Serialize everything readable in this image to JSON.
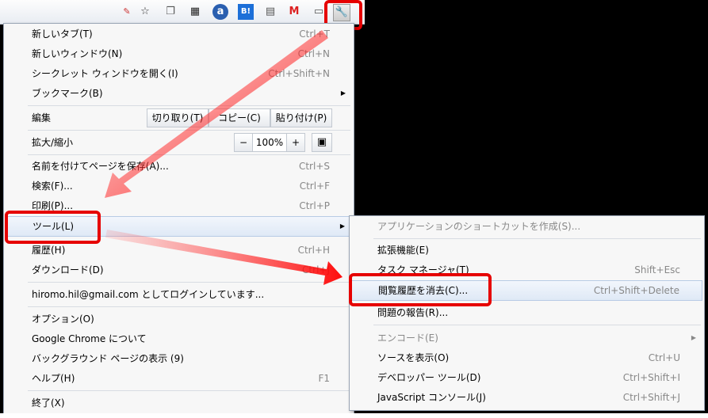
{
  "toolbar": {
    "icons": [
      "star-icon",
      "window-icon",
      "qr-icon",
      "a-icon",
      "hatena-bookmark-icon",
      "note-icon",
      "gmail-icon",
      "tab-icon",
      "wrench-icon"
    ],
    "b_label": "B!"
  },
  "main_menu": {
    "new_tab": {
      "label": "新しいタブ(T)",
      "shortcut": "Ctrl+T"
    },
    "new_window": {
      "label": "新しいウィンドウ(N)",
      "shortcut": "Ctrl+N"
    },
    "incognito": {
      "label": "シークレット ウィンドウを開く(I)",
      "shortcut": "Ctrl+Shift+N"
    },
    "bookmarks": {
      "label": "ブックマーク(B)"
    },
    "edit": {
      "label": "編集",
      "cut": "切り取り(T)",
      "copy": "コピー(C)",
      "paste": "貼り付け(P)"
    },
    "zoom": {
      "label": "拡大/縮小",
      "minus": "−",
      "value": "100%",
      "plus": "+"
    },
    "save_as": {
      "label": "名前を付けてページを保存(A)...",
      "shortcut": "Ctrl+S"
    },
    "find": {
      "label": "検索(F)...",
      "shortcut": "Ctrl+F"
    },
    "print": {
      "label": "印刷(P)...",
      "shortcut": "Ctrl+P"
    },
    "tools": {
      "label": "ツール(L)"
    },
    "history": {
      "label": "履歴(H)",
      "shortcut": "Ctrl+H"
    },
    "downloads": {
      "label": "ダウンロード(D)",
      "shortcut": "Ctrl+J"
    },
    "signed_in": {
      "label": "hiromo.hil@gmail.com としてログインしています..."
    },
    "options": {
      "label": "オプション(O)"
    },
    "about": {
      "label": "Google Chrome について"
    },
    "background": {
      "label": "バックグラウンド ページの表示 (9)"
    },
    "help": {
      "label": "ヘルプ(H)",
      "shortcut": "F1"
    },
    "exit": {
      "label": "終了(X)"
    }
  },
  "sub_menu": {
    "create_shortcut": {
      "label": "アプリケーションのショートカットを作成(S)..."
    },
    "extensions": {
      "label": "拡張機能(E)"
    },
    "task_manager": {
      "label": "タスク マネージャ(T)",
      "shortcut": "Shift+Esc"
    },
    "clear_data": {
      "label": "閲覧履歴を消去(C)...",
      "shortcut": "Ctrl+Shift+Delete"
    },
    "report_issue": {
      "label": "問題の報告(R)..."
    },
    "encoding": {
      "label": "エンコード(E)"
    },
    "view_source": {
      "label": "ソースを表示(O)",
      "shortcut": "Ctrl+U"
    },
    "dev_tools": {
      "label": "デベロッパー ツール(D)",
      "shortcut": "Ctrl+Shift+I"
    },
    "js_console": {
      "label": "JavaScript コンソール(J)",
      "shortcut": "Ctrl+Shift+J"
    }
  },
  "colors": {
    "highlight_red": "#e60000",
    "menu_bg": "#f7f7f7"
  }
}
